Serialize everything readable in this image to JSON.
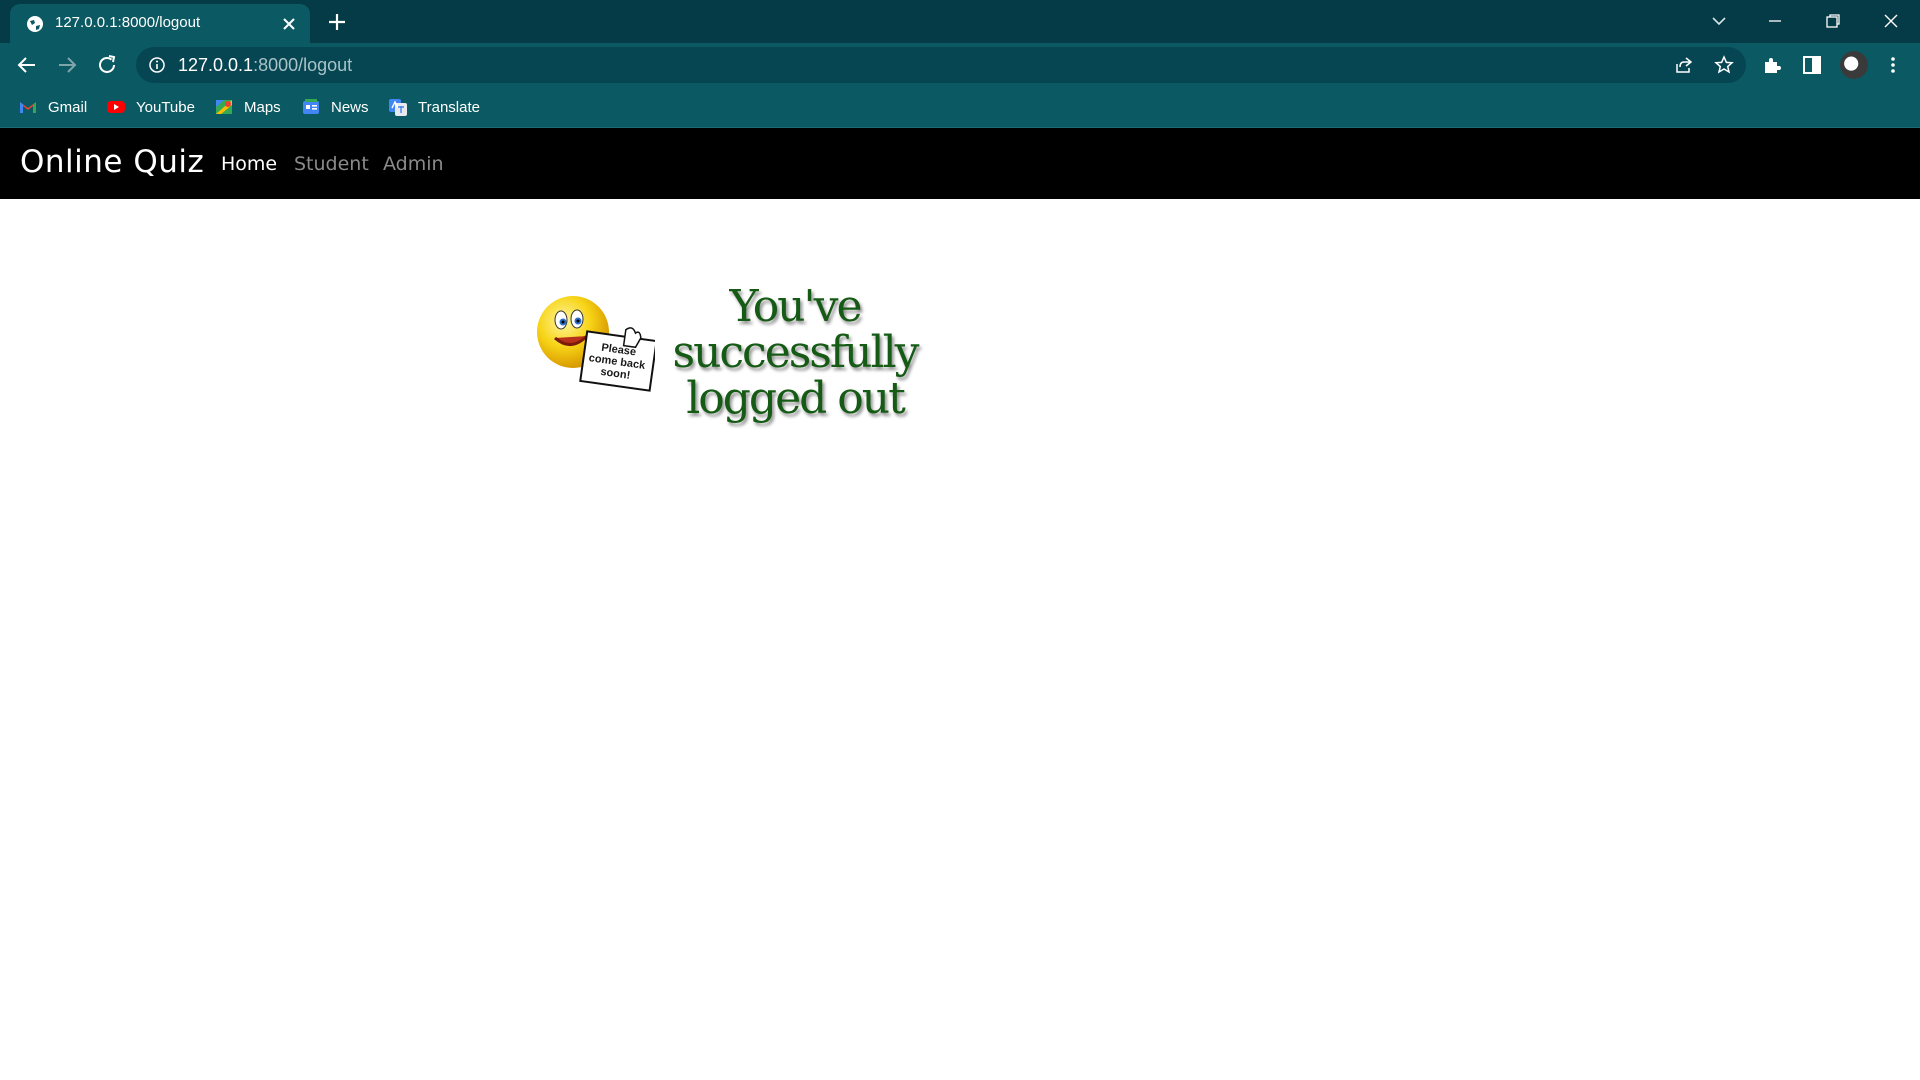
{
  "browser": {
    "tab": {
      "title": "127.0.0.1:8000/logout"
    },
    "address": {
      "host": "127.0.0.1",
      "path": ":8000/logout"
    },
    "bookmarks": [
      {
        "label": "Gmail",
        "icon": "gmail-icon"
      },
      {
        "label": "YouTube",
        "icon": "youtube-icon"
      },
      {
        "label": "Maps",
        "icon": "maps-icon"
      },
      {
        "label": "News",
        "icon": "news-icon"
      },
      {
        "label": "Translate",
        "icon": "translate-icon"
      }
    ],
    "colors": {
      "tabbar": "#053b46",
      "toolbar": "#0b5962"
    }
  },
  "site": {
    "brand": "Online Quiz",
    "nav": [
      {
        "label": "Home",
        "active": true
      },
      {
        "label": "Student",
        "active": false
      },
      {
        "label": "Admin",
        "active": false
      }
    ]
  },
  "logout_image": {
    "message_line1": "You've successfully",
    "message_line2": "logged out",
    "sign_text": "Please come back soon!"
  }
}
